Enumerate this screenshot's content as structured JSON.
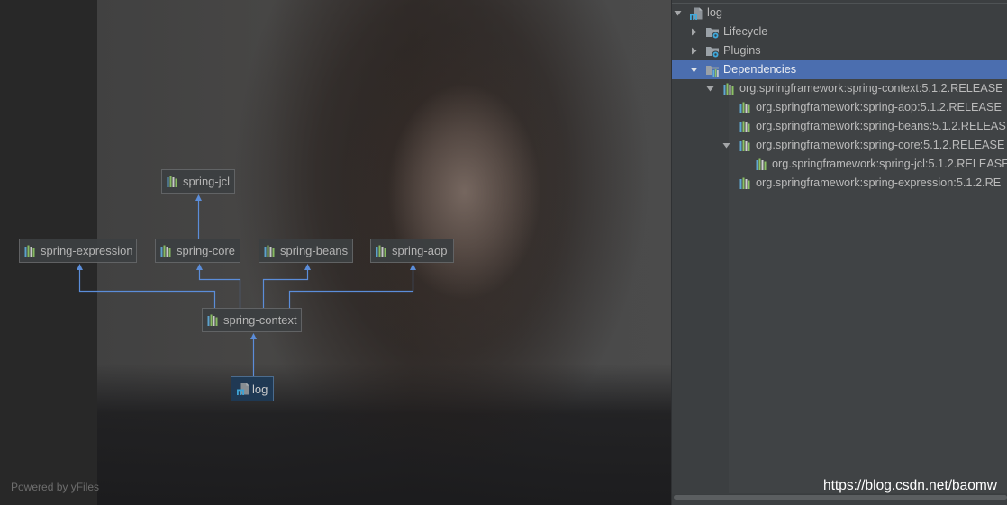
{
  "diagram": {
    "nodes": {
      "spring_jcl": {
        "label": "spring-jcl",
        "icon": "library-icon"
      },
      "spring_expression": {
        "label": "spring-expression",
        "icon": "library-icon"
      },
      "spring_core": {
        "label": "spring-core",
        "icon": "library-icon"
      },
      "spring_beans": {
        "label": "spring-beans",
        "icon": "library-icon"
      },
      "spring_aop": {
        "label": "spring-aop",
        "icon": "library-icon"
      },
      "spring_context": {
        "label": "spring-context",
        "icon": "library-icon"
      },
      "log": {
        "label": "log",
        "icon": "maven-module-icon",
        "selected": true
      }
    },
    "powered_by": "Powered by yFiles"
  },
  "maven_tree": {
    "root": {
      "label": "log",
      "icon": "maven-module-icon",
      "expanded": true,
      "children": [
        {
          "label": "Lifecycle",
          "icon": "lifecycle-folder-icon",
          "expanded": false
        },
        {
          "label": "Plugins",
          "icon": "plugins-folder-icon",
          "expanded": false
        },
        {
          "label": "Dependencies",
          "icon": "dependencies-folder-icon",
          "expanded": true,
          "selected": true,
          "children": [
            {
              "label": "org.springframework:spring-context:5.1.2.RELEASE",
              "icon": "library-icon",
              "expanded": true,
              "children": [
                {
                  "label": "org.springframework:spring-aop:5.1.2.RELEASE",
                  "icon": "library-icon"
                },
                {
                  "label": "org.springframework:spring-beans:5.1.2.RELEAS",
                  "icon": "library-icon"
                },
                {
                  "label": "org.springframework:spring-core:5.1.2.RELEASE",
                  "icon": "library-icon",
                  "expanded": true,
                  "children": [
                    {
                      "label": "org.springframework:spring-jcl:5.1.2.RELEASE",
                      "icon": "library-icon"
                    }
                  ]
                },
                {
                  "label": "org.springframework:spring-expression:5.1.2.RE",
                  "icon": "library-icon"
                }
              ]
            }
          ]
        }
      ]
    }
  },
  "watermark": {
    "text": "https://blog.csdn.net/baomw"
  },
  "colors": {
    "selection": "#4b6eaf",
    "edge": "#5b8dd9",
    "node_background": "#3c3f41",
    "node_border": "#636567",
    "selected_node_background": "#1f3a56",
    "panel_background": "#3c3f41",
    "text": "#bbbbbb"
  }
}
